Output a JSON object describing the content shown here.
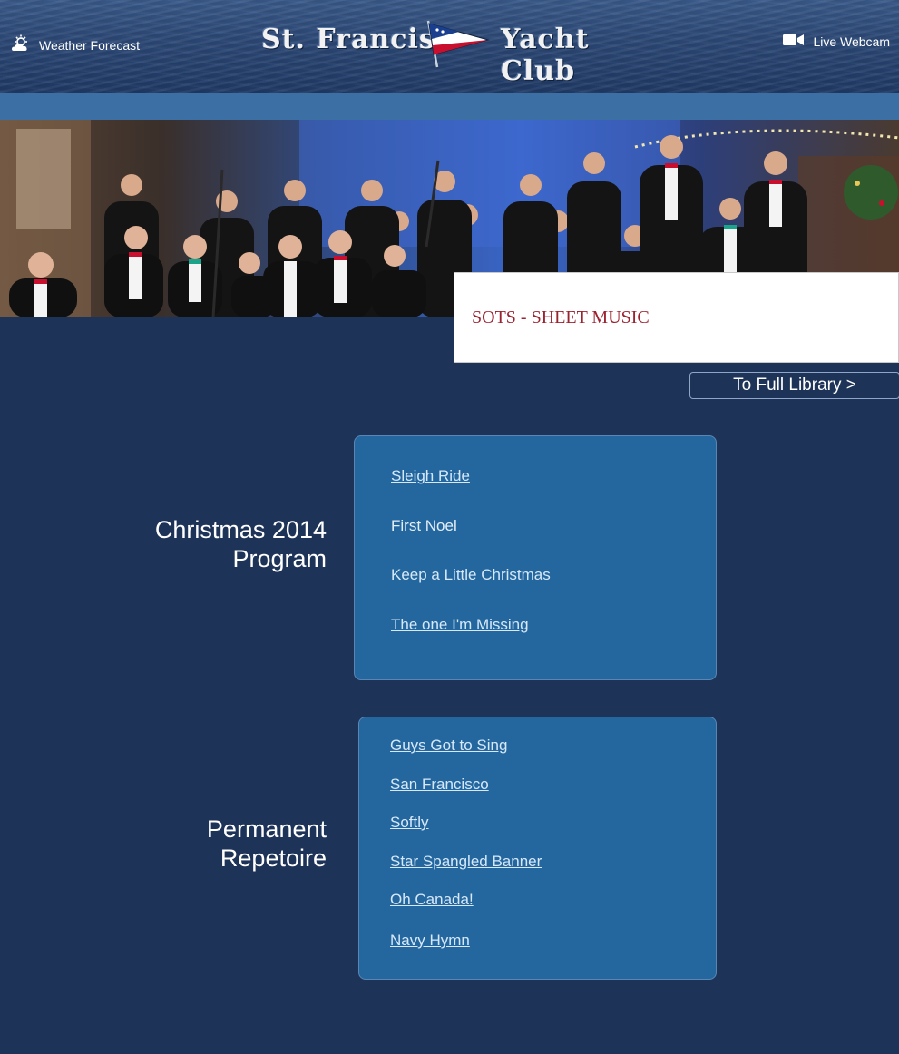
{
  "header": {
    "weather_label": "Weather Forecast",
    "webcam_label": "Live Webcam",
    "brand_left": "St. Francis",
    "brand_right": "Yacht Club"
  },
  "page": {
    "title": "SOTS - SHEET MUSIC",
    "full_library_button": "To Full Library >"
  },
  "sections": [
    {
      "label_line1": "Christmas 2014",
      "label_line2": "Program",
      "songs": [
        {
          "title": "Sleigh Ride",
          "linked": true
        },
        {
          "title": "First Noel",
          "linked": false
        },
        {
          "title": "Keep a Little Christmas",
          "linked": true
        },
        {
          "title": "The one I'm Missing",
          "linked": true
        }
      ]
    },
    {
      "label_line1": "Permanent",
      "label_line2": "Repetoire",
      "songs": [
        {
          "title": "Guys Got to Sing",
          "linked": true
        },
        {
          "title": "San Francisco",
          "linked": true
        },
        {
          "title": "Softly",
          "linked": true
        },
        {
          "title": "Star Spangled Banner",
          "linked": true
        },
        {
          "title": "Oh Canada!",
          "linked": true
        },
        {
          "title": "Navy Hymn",
          "linked": true
        }
      ]
    }
  ],
  "colors": {
    "page_background": "#1e3358",
    "band": "#3c6fa4",
    "song_box": "#24679e",
    "title_red": "#9b2330",
    "link": "#d6e8fa"
  },
  "icons": {
    "weather": "weather-sun-cloud-icon",
    "webcam": "video-camera-icon",
    "burgee": "burgee-flag-icon"
  }
}
